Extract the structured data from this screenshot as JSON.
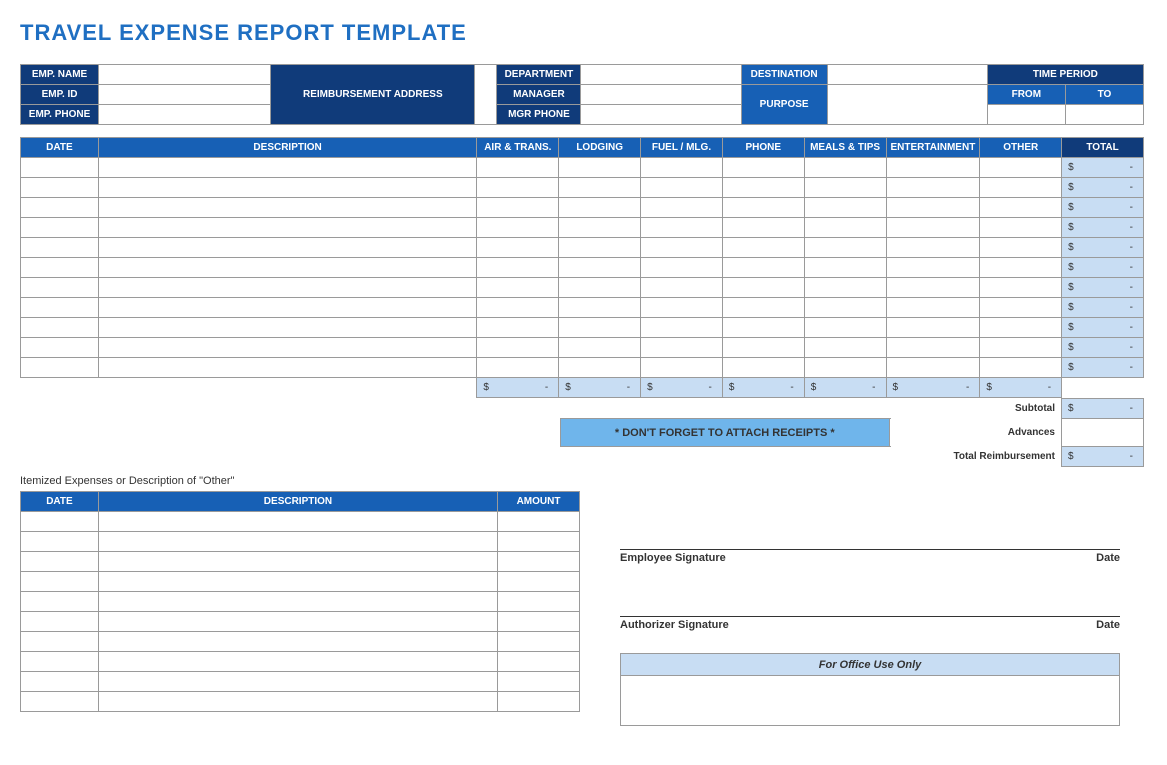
{
  "title": "TRAVEL EXPENSE REPORT TEMPLATE",
  "info": {
    "emp_name": "EMP. NAME",
    "emp_id": "EMP. ID",
    "emp_phone": "EMP. PHONE",
    "reimb_addr": "REIMBURSEMENT ADDRESS",
    "department": "DEPARTMENT",
    "manager": "MANAGER",
    "mgr_phone": "MGR PHONE",
    "destination": "DESTINATION",
    "purpose": "PURPOSE",
    "time_period": "TIME PERIOD",
    "from": "FROM",
    "to": "TO"
  },
  "cols": {
    "date": "DATE",
    "description": "DESCRIPTION",
    "air": "AIR & TRANS.",
    "lodging": "LODGING",
    "fuel": "FUEL / MLG.",
    "phone": "PHONE",
    "meals": "MEALS & TIPS",
    "ent": "ENTERTAINMENT",
    "other": "OTHER",
    "total": "TOTAL",
    "amount": "AMOUNT"
  },
  "currency": "$",
  "dash": "-",
  "summary": {
    "subtotal": "Subtotal",
    "advances": "Advances",
    "total_reimb": "Total Reimbursement"
  },
  "receipt_note": "* DON'T FORGET TO ATTACH RECEIPTS *",
  "itemized_label": "Itemized Expenses or Description of \"Other\"",
  "sig": {
    "employee": "Employee Signature",
    "authorizer": "Authorizer Signature",
    "date": "Date"
  },
  "office_use": "For Office Use Only"
}
